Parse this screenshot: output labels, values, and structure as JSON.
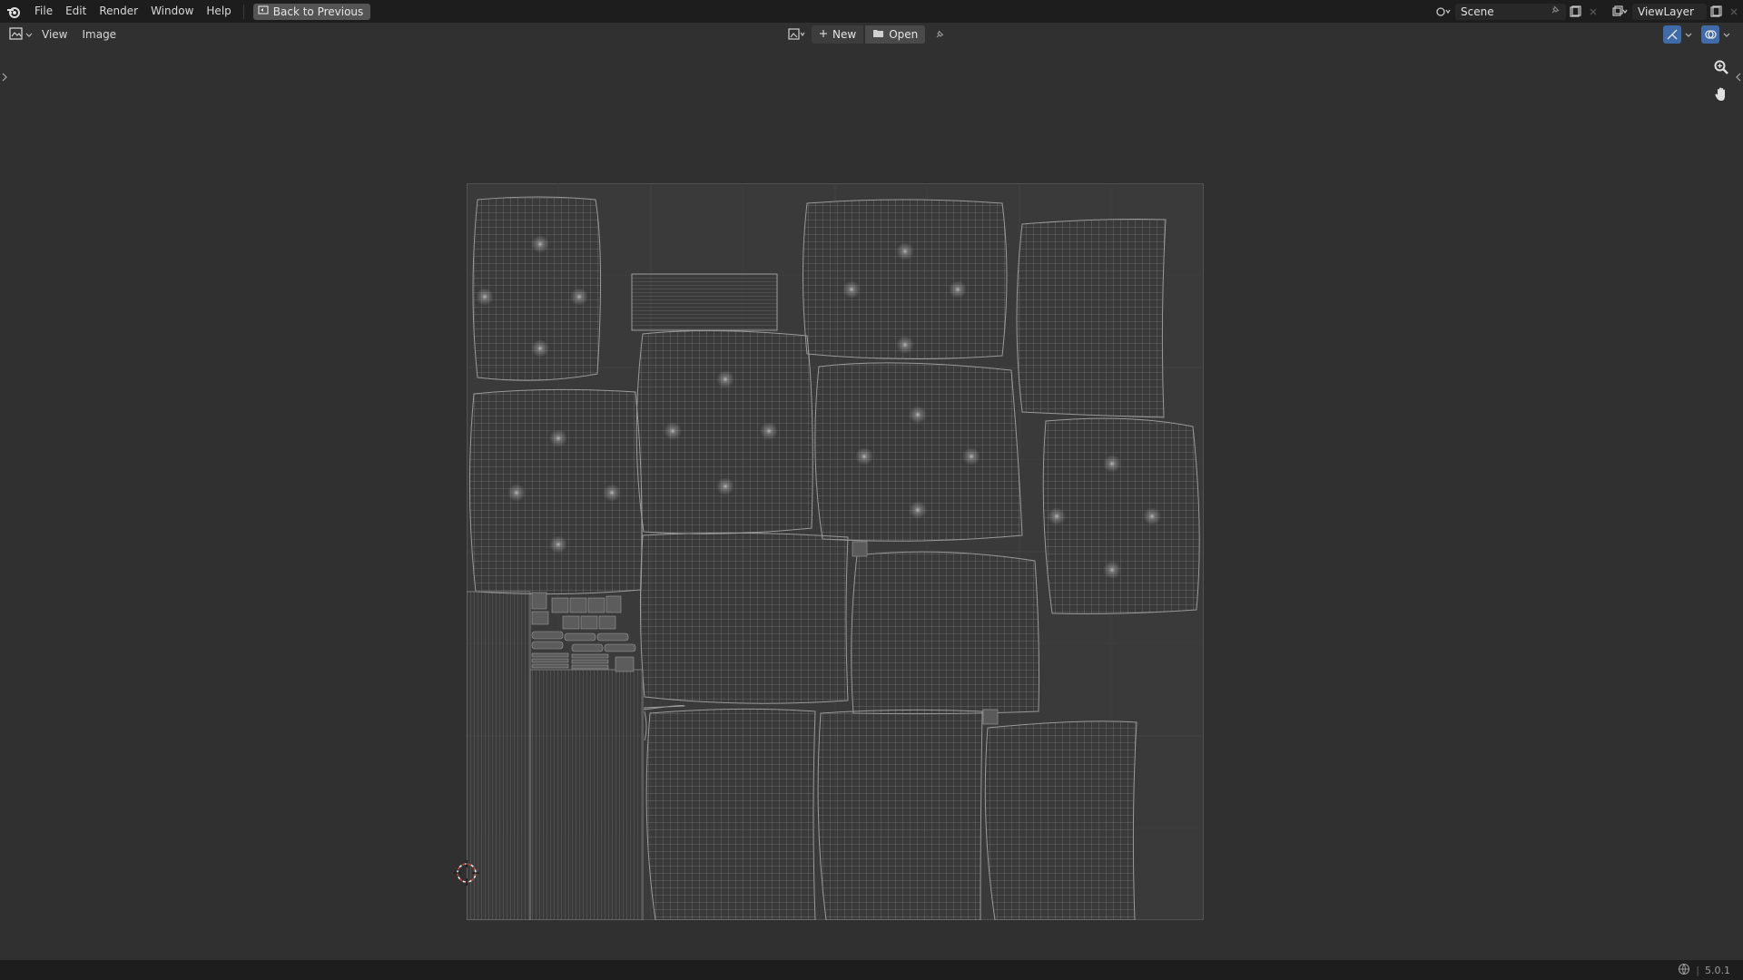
{
  "topbar": {
    "menus": [
      "File",
      "Edit",
      "Render",
      "Window",
      "Help"
    ],
    "back_button": "Back to Previous",
    "scene_name": "Scene",
    "view_layer": "ViewLayer"
  },
  "editor_header": {
    "menus": [
      "View",
      "Image"
    ],
    "new_label": "New",
    "open_label": "Open"
  },
  "status": {
    "version": "5.0.1"
  },
  "icons": {
    "logo": "blender-logo-icon",
    "back": "back-to-previous-icon",
    "pin": "pin-icon",
    "zoom": "zoom-icon",
    "pan": "hand-icon",
    "cursor": "2d-cursor-icon"
  },
  "colors": {
    "accent": "#3f6ba8",
    "background": "#303030",
    "header": "#1d1d1d",
    "uv_wire": "#a0a0a0",
    "cursor_red": "#d04040"
  }
}
